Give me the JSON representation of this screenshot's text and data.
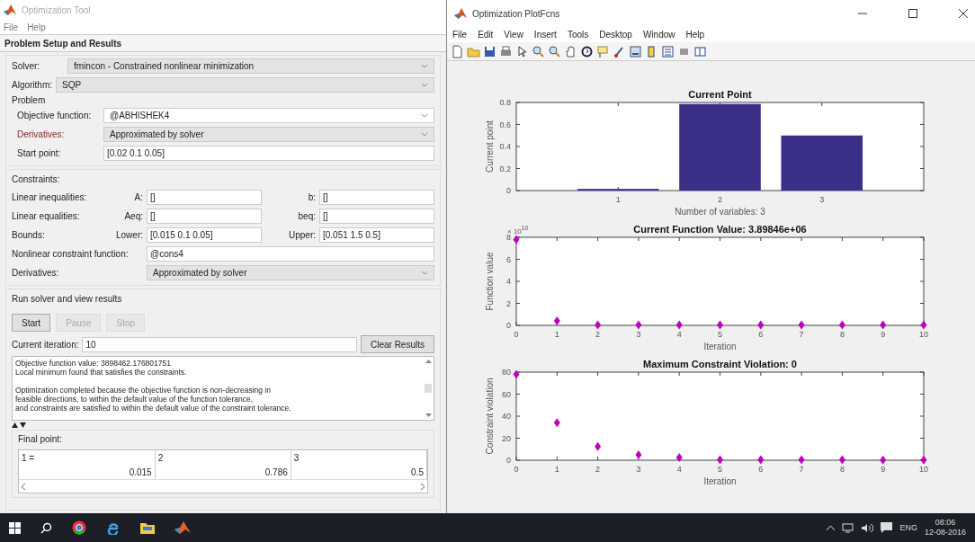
{
  "tool_window": {
    "title": "Optimization Tool",
    "menu": [
      "File",
      "Help"
    ],
    "section_title": "Problem Setup and Results",
    "solver": {
      "label": "Solver:",
      "value": "fmincon - Constrained nonlinear minimization"
    },
    "algorithm": {
      "label": "Algorithm:",
      "value": "SQP"
    },
    "problem": {
      "title": "Problem",
      "objective": {
        "label": "Objective function:",
        "value": "@ABHISHEK4"
      },
      "derivatives": {
        "label": "Derivatives:",
        "value": "Approximated by solver"
      },
      "start_point": {
        "label": "Start point:",
        "value": "[0.02 0.1 0.05]"
      }
    },
    "constraints": {
      "title": "Constraints:",
      "rows": [
        {
          "label": "Linear inequalities:",
          "field1_label": "A:",
          "field1": "[]",
          "field2_label": "b:",
          "field2": "[]"
        },
        {
          "label": "Linear equalities:",
          "field1_label": "Aeq:",
          "field1": "[]",
          "field2_label": "beq:",
          "field2": "[]"
        },
        {
          "label": "Bounds:",
          "field1_label": "Lower:",
          "field1": "[0.015 0.1 0.05]",
          "field2_label": "Upper:",
          "field2": "[0.051 1.5 0.5]"
        }
      ],
      "nonlinear": {
        "label": "Nonlinear constraint function:",
        "value": "@cons4"
      },
      "derivatives": {
        "label": "Derivatives:",
        "value": "Approximated by solver"
      }
    },
    "run": {
      "title": "Run solver and view results",
      "buttons": [
        {
          "label": "Start",
          "disabled": false
        },
        {
          "label": "Pause",
          "disabled": true
        },
        {
          "label": "Stop",
          "disabled": true
        }
      ],
      "iteration": {
        "label": "Current iteration:",
        "value": "10"
      },
      "clear_button": "Clear Results",
      "messages": [
        [
          "Objective function value: 3898462.176801751",
          "Local minimum found that satisfies the constraints."
        ],
        [
          "Optimization completed because the objective function is non-decreasing in",
          "feasible directions, to within the default value of the function tolerance,",
          "and constraints are satisfied to within the default value of the constraint tolerance."
        ]
      ],
      "final_point": {
        "title": "Final point:",
        "columns": [
          "1 =",
          "2",
          "3"
        ],
        "values": [
          "0.015",
          "0.786",
          "0.5"
        ]
      }
    }
  },
  "plot_window": {
    "title": "Optimization PlotFcns",
    "menu": [
      "File",
      "Edit",
      "View",
      "Insert",
      "Tools",
      "Desktop",
      "Window",
      "Help"
    ],
    "charts": [
      {
        "chart_data": {
          "type": "bar",
          "title": "Current Point",
          "xlabel": "Number of variables: 3",
          "ylabel": "Current point",
          "categories": [
            "1",
            "2",
            "3"
          ],
          "series": [
            {
              "color": "#3b3087",
              "values": [
                0.015,
                0.786,
                0.5
              ]
            }
          ],
          "ylim": [
            0,
            0.8
          ],
          "yticks": [
            0,
            0.2,
            0.4,
            0.6,
            0.8
          ]
        }
      },
      {
        "chart_data": {
          "type": "scatter",
          "title": "Current Function Value: 3.89846e+06",
          "xlabel": "Iteration",
          "ylabel": "Function value",
          "x": [
            0,
            1,
            2,
            3,
            4,
            5,
            6,
            7,
            8,
            9,
            10
          ],
          "series": [
            {
              "color": "#bf00bf",
              "values": [
                7.8,
                0.4,
                0.05,
                0.04,
                0.04,
                0.04,
                0.04,
                0.04,
                0.04,
                0.04,
                0.04
              ]
            }
          ],
          "xlim": [
            0,
            10
          ],
          "ylim": [
            0,
            8
          ],
          "xticks": [
            0,
            1,
            2,
            3,
            4,
            5,
            6,
            7,
            8,
            9,
            10
          ],
          "yticks": [
            0,
            2,
            4,
            6,
            8
          ],
          "annotations": [
            "× 10$^{10}$"
          ]
        }
      },
      {
        "chart_data": {
          "type": "scatter",
          "title": "Maximum Constraint Violation: 0",
          "xlabel": "Iteration",
          "ylabel": "Constraint violation",
          "x": [
            0,
            1,
            2,
            3,
            4,
            5,
            6,
            7,
            8,
            9,
            10
          ],
          "series": [
            {
              "color": "#bf00bf",
              "values": [
                78,
                34,
                12.5,
                5,
                2.5,
                0.5,
                0.5,
                0.5,
                0.5,
                0.2,
                0.2
              ]
            }
          ],
          "xlim": [
            0,
            10
          ],
          "ylim": [
            0,
            80
          ],
          "xticks": [
            0,
            1,
            2,
            3,
            4,
            5,
            6,
            7,
            8,
            9,
            10
          ],
          "yticks": [
            0,
            20,
            40,
            60,
            80
          ]
        }
      }
    ]
  },
  "taskbar": {
    "language": "ENG",
    "time": "08:06",
    "date": "12-08-2016"
  }
}
